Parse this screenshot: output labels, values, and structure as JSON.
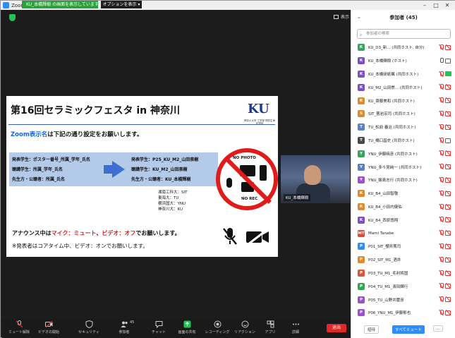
{
  "titlebar": {
    "app_name": "Zoom",
    "share_banner": "KU_本橋輝樹 の画面を表示しています",
    "view_options": "オプションを表示 ▾",
    "minimize": "–",
    "maximize": "□",
    "close": "✕"
  },
  "meeting": {
    "view_label": "表示"
  },
  "slide": {
    "title": "第16回セラミックフェスタ in 神奈川",
    "logo": "KU",
    "logo_sub": "神奈川大学 工学部 物質生命化学科",
    "instruction_highlight": "Zoom表示名",
    "instruction_rest": "は下記の通り設定をお願いします。",
    "left_rows": [
      "発表学生：ポスター番号_所属_学年_氏名",
      "聴講学生：所属_学年_氏名",
      "先生方・公聴者：所属_氏名"
    ],
    "right_rows": [
      "発表学生：P25_KU_M2_山田崇樹",
      "聴講学生：KU_M2_山田崇樹",
      "先生方・公聴者：KU_本橋輝樹"
    ],
    "abbreviations": [
      "湘南工科大：SIT",
      "東海大：TU",
      "横浜国大：YNU",
      "神奈川大：KU"
    ],
    "no_photo": "NO PHOTO",
    "no_rec": "NO REC",
    "announce_a": "アナウンス中は",
    "announce_b": "マイク：ミュート",
    "announce_c": "、",
    "announce_d": "ビデオ：オフ",
    "announce_e": "でお願いします。",
    "note": "※発表者はコアタイム中、ビデオ：オンでお願いします。"
  },
  "video_thumb": {
    "name": "KU_本橋輝樹"
  },
  "toolbar": {
    "mute": "ミュート解除",
    "video": "ビデオの開始",
    "security": "セキュリティ",
    "participants": "参加者",
    "participants_count": "45",
    "chat": "チャット",
    "share": "画面の共有",
    "record": "レコーディング",
    "reactions": "リアクション",
    "apps": "アプリ",
    "details": "詳細",
    "end": "退出"
  },
  "panel": {
    "title": "参加者 (45)",
    "search_placeholder": "参加者の検索",
    "participants": [
      {
        "initial": "K",
        "color": "#3aa35a",
        "name": "KU_D3_新... (共同ホスト, 自分)",
        "mic": "off",
        "video": "off"
      },
      {
        "initial": "K",
        "color": "#7a4fc8",
        "name": "KU_本橋輝樹 (ホスト)",
        "mic": "on",
        "video": "grey"
      },
      {
        "initial": "K",
        "color": "#7a4fc8",
        "name": "KU_本橋研紙楓 (共同ホスト)",
        "mic": "off",
        "video": "on"
      },
      {
        "initial": "K",
        "color": "#7a4fc8",
        "name": "KU_M2_山田崇... (共同ホスト)",
        "mic": "off",
        "video": "off"
      },
      {
        "initial": "K",
        "color": "#e08a2d",
        "name": "KU_齋藤美和 (共同ホスト)",
        "mic": "off",
        "video": "off"
      },
      {
        "initial": "S",
        "color": "#e08a2d",
        "name": "SIT_舊岩宏司 (共同ホスト)",
        "mic": "off",
        "video": "off"
      },
      {
        "initial": "T",
        "color": "#5a7fc2",
        "name": "TU_松前 義治 (共同ホスト)",
        "mic": "off",
        "video": "off"
      },
      {
        "initial": "T",
        "color": "#4a4a4a",
        "name": "TU_橋口昌史 (共同ホスト)",
        "mic": "off",
        "video": "grey"
      },
      {
        "initial": "Y",
        "color": "#3aa35a",
        "name": "YNU_伊藤暁彦 (共同ホスト)",
        "mic": "off",
        "video": "off"
      },
      {
        "initial": "Y",
        "color": "#5a7fc2",
        "name": "YNU_多々見純一 (共同ホスト)",
        "mic": "off",
        "video": "off"
      },
      {
        "initial": "Y",
        "color": "#9b4fd1",
        "name": "YNU_飯島志行 (共同ホスト)",
        "mic": "off",
        "video": "off"
      },
      {
        "initial": "K",
        "color": "#e08a2d",
        "name": "KU_B4_山田智敬",
        "mic": "off",
        "video": "off"
      },
      {
        "initial": "K",
        "color": "#e08a2d",
        "name": "KU_B4_小田内健佑",
        "mic": "off",
        "video": "off"
      },
      {
        "initial": "K",
        "color": "#7a4fc8",
        "name": "KU_B4_西原悠翔",
        "mic": "off",
        "video": "off"
      },
      {
        "initial": "MT",
        "color": "#d94a3c",
        "name": "Mami Tanabe",
        "mic": "off",
        "video": "off"
      },
      {
        "initial": "P",
        "color": "#2d8cff",
        "name": "P01_SIT_櫻井篤司",
        "mic": "off",
        "video": "off"
      },
      {
        "initial": "P",
        "color": "#e08a2d",
        "name": "P02_SIT_M1_酒井",
        "mic": "off",
        "video": "off"
      },
      {
        "initial": "P",
        "color": "#d9563c",
        "name": "P03_TU_M1_毛利将国",
        "mic": "off",
        "video": "off"
      },
      {
        "initial": "P",
        "color": "#3aa35a",
        "name": "P04_TU_M1_濱田輝行",
        "mic": "off",
        "video": "off"
      },
      {
        "initial": "P",
        "color": "#9b4fd1",
        "name": "P05_TU_山野井慶彦",
        "mic": "off",
        "video": "off"
      },
      {
        "initial": "P",
        "color": "#9b4fd1",
        "name": "P06_YNU_M1_伊藤郁也",
        "mic": "off",
        "video": "off"
      }
    ],
    "invite": "招待",
    "mute_all": "すべてミュート",
    "more": "..."
  },
  "colors": {
    "accent": "#2d8cff",
    "danger": "#e02828",
    "share_green": "#2aa13a"
  }
}
